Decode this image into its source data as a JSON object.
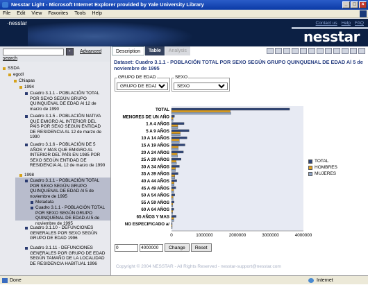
{
  "window": {
    "title": "Nesstar Light - Microsoft Internet Explorer provided by Yale University Library"
  },
  "menu": [
    "File",
    "Edit",
    "View",
    "Favorites",
    "Tools",
    "Help"
  ],
  "header": {
    "small_brand": "·nesstar",
    "links": [
      "Contact us",
      "Help",
      "FAQ"
    ],
    "brand": "nesstar"
  },
  "search": {
    "advanced": "Advanced",
    "search": "search",
    "go": "›"
  },
  "tabs": {
    "description": "Description",
    "table": "Table",
    "analysis": "Analysis"
  },
  "tree": [
    {
      "label": "SSDA",
      "level": 0,
      "bullet": "y"
    },
    {
      "label": "egcdl",
      "level": 1,
      "bullet": "y"
    },
    {
      "label": "Chiapas",
      "level": 2,
      "bullet": "y"
    },
    {
      "label": "1994",
      "level": 3,
      "bullet": "y"
    },
    {
      "label": "Cuadro 3.1.1 - POBLACIÓN TOTAL POR SEXO SEGÚN GRUPO QUINQUENAL DE EDAD Al 12 de marzo de 1990",
      "level": 4,
      "bullet": "b"
    },
    {
      "label": "Cuadro 3.1.5 - POBLACIÓN NATIVA QUE EMIGRO AL INTERIOR DEL PAÍS POR SEXO SEGÚN ENTIDAD DE RESIDENCIA AL 12 de marzo de 1990",
      "level": 4,
      "bullet": "b"
    },
    {
      "label": "Cuadro 3.1.6 - POBLACIÓN DE 5 AÑOS Y MAS QUE EMIGRO AL INTERIOR DEL PAÍS EN 1985 POR SEXO SEGÚN ENTIDAD DE RESIDENCIA AL 12 de marzo de 1990",
      "level": 4,
      "bullet": "b"
    },
    {
      "label": "1998",
      "level": 3,
      "bullet": "y"
    },
    {
      "label": "Cuadro 3.1.1 - POBLACIÓN TOTAL POR SEXO SEGÚN GRUPO QUINQUENAL DE EDAD Al 5 de noviembre de 1995",
      "level": 4,
      "bullet": "b"
    },
    {
      "label": "Metadata",
      "level": 5,
      "bullet": "b"
    },
    {
      "label": "Cuadro 3.1.1 - POBLACIÓN TOTAL POR SEXO SEGÚN GRUPO QUINQUENAL DE EDAD Al 5 de noviembre de 1995",
      "level": 5,
      "bullet": "b"
    },
    {
      "label": "Cuadro 3.1.10 - DEFUNCIONES GENERALES POR SEXO SEGÚN GRUPO DE EDAD 1996",
      "level": 4,
      "bullet": "b"
    },
    {
      "label": "Cuadro 3.1.11 - DEFUNCIONES GENERALES POR GRUPO DE EDAD SEGÚN TAMAÑO DE LA LOCALIDAD DE RESIDENCIA HABITUAL 1996",
      "level": 4,
      "bullet": "b"
    }
  ],
  "dataset": "Dataset: Cuadro 3.1.1 - POBLACIÓN TOTAL POR SEXO SEGÚN GRUPO QUINQUENAL DE EDAD Al 5 de noviembre de 1995",
  "filters": {
    "grupo": {
      "legend": "GRUPO DE EDAD",
      "value": "GRUPO DE EDAD"
    },
    "sexo": {
      "legend": "SEXO",
      "value": "SEXO"
    }
  },
  "controls": {
    "min": "0",
    "max": "4000000",
    "change": "Change",
    "reset": "Reset"
  },
  "chart_data": {
    "type": "bar",
    "orientation": "horizontal",
    "categories": [
      "TOTAL",
      "MENORES DE UN AÑO",
      "1 A 4 AÑOS",
      "5 A 9 AÑOS",
      "10 A 14 AÑOS",
      "15 A 19 AÑOS",
      "20 A 24 AÑOS",
      "25 A 29 AÑOS",
      "30 A 34 AÑOS",
      "35 A 39 AÑOS",
      "40 A 44 AÑOS",
      "45 A 49 AÑOS",
      "50 A 54 AÑOS",
      "55 A 59 AÑOS",
      "60 A 64 AÑOS",
      "65 AÑOS Y MAS",
      "NO ESPECIFICADO a/"
    ],
    "series": [
      {
        "name": "TOTAL",
        "color": "#2f4577",
        "values": [
          3580000,
          90000,
          380000,
          530000,
          470000,
          410000,
          360000,
          290000,
          240000,
          200000,
          160000,
          130000,
          100000,
          80000,
          70000,
          140000,
          20000
        ]
      },
      {
        "name": "HOMBRES",
        "color": "#e0a020",
        "values": [
          1780000,
          45000,
          190000,
          265000,
          235000,
          205000,
          175000,
          140000,
          120000,
          100000,
          80000,
          65000,
          50000,
          40000,
          35000,
          70000,
          10000
        ]
      },
      {
        "name": "MUJERES",
        "color": "#8ea4c4",
        "values": [
          1800000,
          45000,
          190000,
          265000,
          235000,
          205000,
          185000,
          150000,
          120000,
          100000,
          80000,
          65000,
          50000,
          40000,
          35000,
          70000,
          10000
        ]
      }
    ],
    "xticks": [
      "0",
      "1000000",
      "2000000",
      "3000000",
      "4000000"
    ],
    "xlim": [
      0,
      4000000
    ]
  },
  "footer": {
    "copyright": "Copyright © 2004 NESSTAR - All Rights Reserved - nesstar-support@nesstar.com"
  },
  "status": {
    "done": "Done",
    "zone": "Internet"
  }
}
